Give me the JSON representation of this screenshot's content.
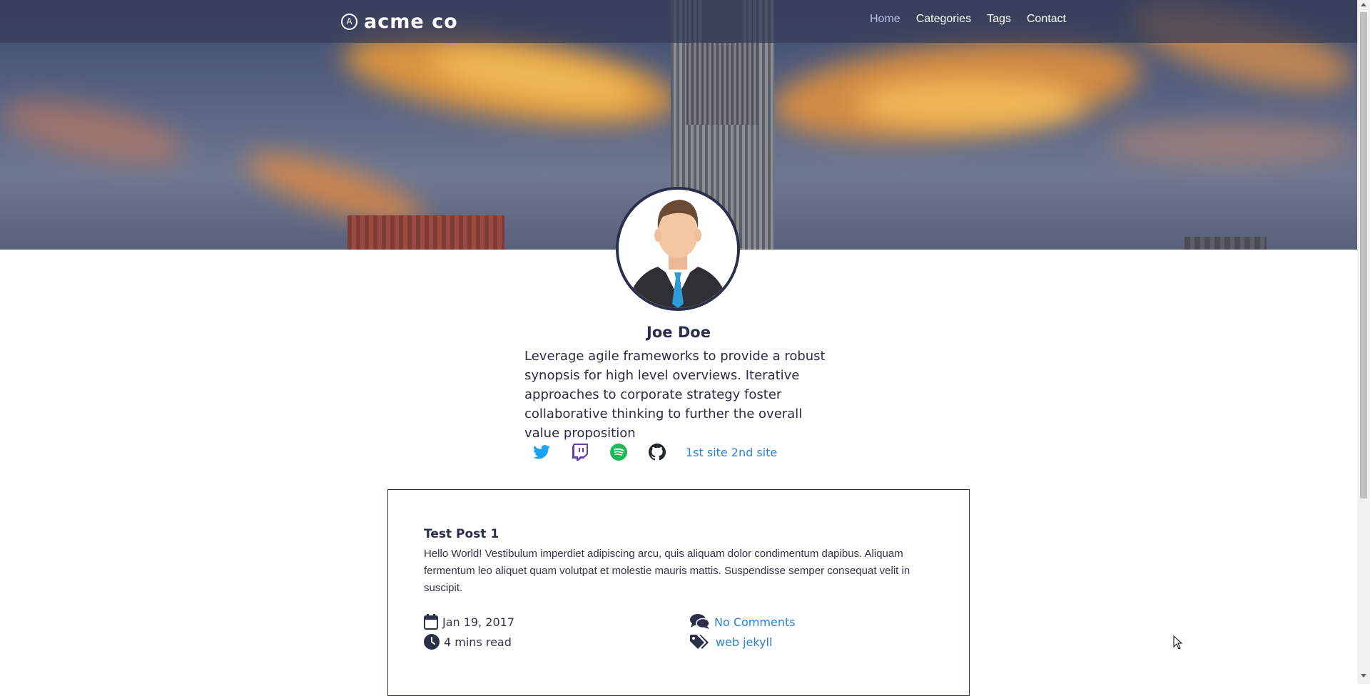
{
  "brand": {
    "logo_mark": "A",
    "name": "acme co"
  },
  "nav": {
    "items": [
      {
        "label": "Home",
        "active": true
      },
      {
        "label": "Categories"
      },
      {
        "label": "Tags"
      },
      {
        "label": "Contact"
      }
    ]
  },
  "profile": {
    "name": "Joe Doe",
    "bio": "Leverage agile frameworks to provide a robust synopsis for high level overviews. Iterative approaches to corporate strategy foster collaborative thinking to further the overall value proposition",
    "social": [
      {
        "icon": "twitter-icon",
        "color": "#1da1f2"
      },
      {
        "icon": "twitch-icon",
        "color": "#6441a5"
      },
      {
        "icon": "spotify-icon",
        "color": "#1db954"
      },
      {
        "icon": "github-icon",
        "color": "#24292e"
      }
    ],
    "sites": [
      "1st site",
      "2nd site"
    ]
  },
  "post": {
    "title": "Test Post 1",
    "excerpt": "Hello World! Vestibulum imperdiet adipiscing arcu, quis aliquam dolor condimentum dapibus. Aliquam fermentum leo aliquet quam volutpat et molestie mauris mattis. Suspendisse semper consequat velit in suscipit.",
    "date": "Jan 19, 2017",
    "read_time": "4 mins read",
    "comments": "No Comments",
    "tags": [
      "web",
      "jekyll"
    ]
  },
  "colors": {
    "link": "#2a7fd4",
    "dark": "#2c2f4a",
    "nav_bg": "#343b57"
  }
}
